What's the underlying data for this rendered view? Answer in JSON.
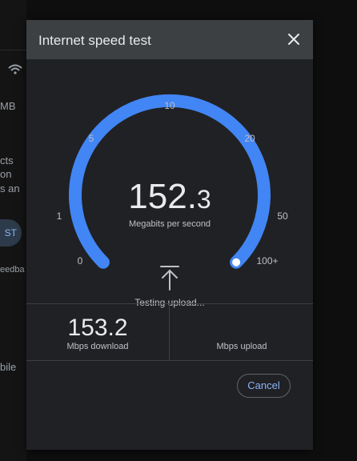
{
  "background": {
    "fragments": [
      "MB",
      "cts",
      "on",
      "s an",
      "ST",
      "eedba",
      "bile"
    ]
  },
  "dialog": {
    "title": "Internet speed test",
    "close_icon": "close-icon"
  },
  "gauge": {
    "value_whole": "152.",
    "value_decimal": "3",
    "unit": "Megabits per second",
    "scale_labels": [
      "0",
      "1",
      "5",
      "10",
      "20",
      "50",
      "100+"
    ],
    "status": "Testing upload...",
    "status_icon": "upload-arrow-icon",
    "arc_progress": 1.0,
    "colors": {
      "arc": "#4285f4",
      "text": "#e8eaed",
      "muted": "#bdc1c6",
      "knob": "#ffffff"
    }
  },
  "results": {
    "download_value": "153.2",
    "download_label": "Mbps download",
    "upload_value": "",
    "upload_label": "Mbps upload"
  },
  "actions": {
    "cancel_label": "Cancel"
  }
}
